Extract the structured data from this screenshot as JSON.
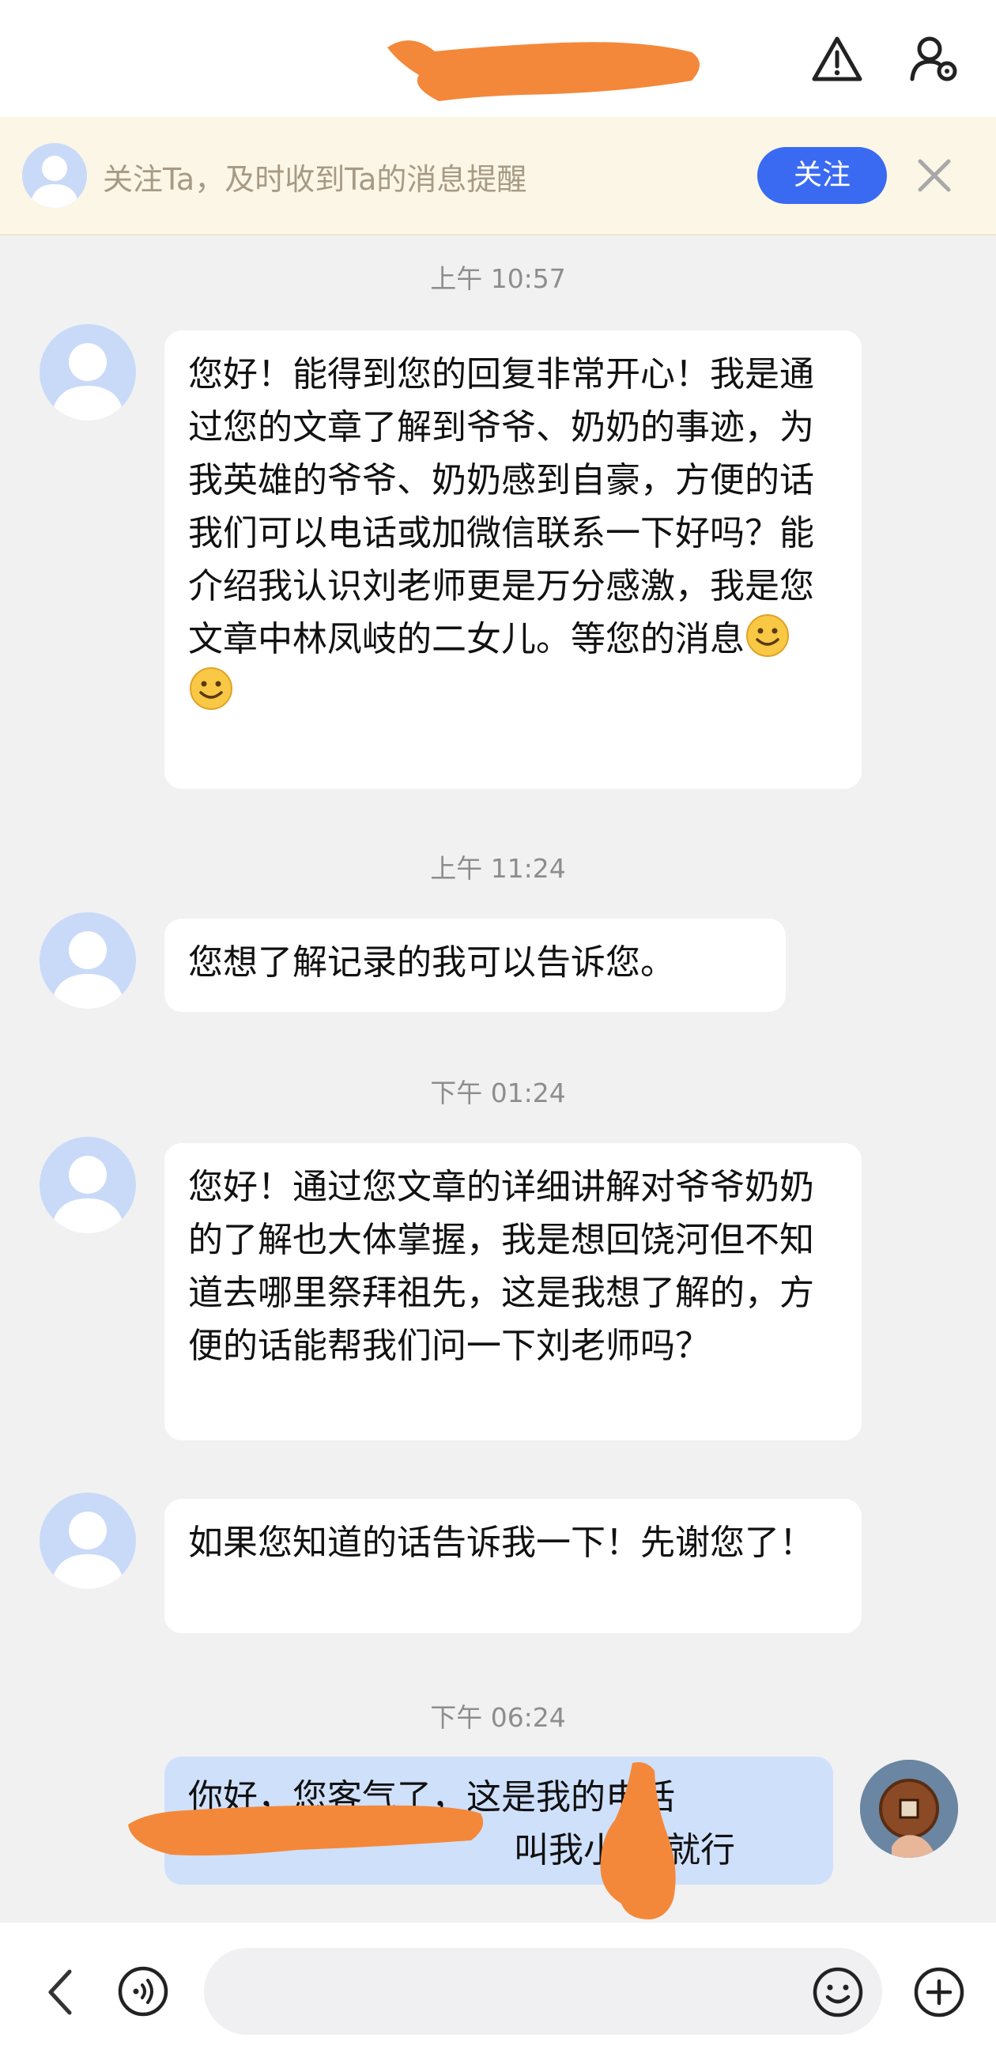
{
  "header": {
    "title": "",
    "warning_icon": "warning-icon",
    "settings_icon": "user-settings-icon"
  },
  "follow_banner": {
    "text": "关注Ta，及时收到Ta的消息提醒",
    "button": "关注",
    "close_icon": "close-icon"
  },
  "messages": [
    {
      "time": "上午 10:57",
      "from": "other",
      "text": "您好！能得到您的回复非常开心！我是通过您的文章了解到爷爷、奶奶的事迹，为我英雄的爷爷、奶奶感到自豪，方便的话我们可以电话或加微信联系一下好吗？能介绍我认识刘老师更是万分感激，我是您文章中林凤岐的二女儿。等您的消息",
      "emojis": [
        "smile-emoji",
        "smile-emoji"
      ]
    },
    {
      "time": "上午 11:24",
      "from": "other",
      "text": "您想了解记录的我可以告诉您。"
    },
    {
      "time": "下午 01:24",
      "from": "other",
      "text": "您好！通过您文章的详细讲解对爷爷奶奶的了解也大体掌握，我是想回饶河但不知道去哪里祭拜祖先，这是我想了解的，方便的话能帮我们问一下刘老师吗？"
    },
    {
      "time": "",
      "from": "other",
      "text": "如果您知道的话告诉我一下！先谢您了！"
    },
    {
      "time": "下午 06:24",
      "from": "me",
      "line1": "你好，您客气了，这是我的电话",
      "line2": "叫我小",
      "line2_end": "就行"
    }
  ],
  "input": {
    "placeholder": "",
    "value": ""
  },
  "colors": {
    "accent": "#3a6af2",
    "banner_bg": "#fcf6e6",
    "my_bubble": "#cfe0fb",
    "redaction": "#f4883a"
  }
}
